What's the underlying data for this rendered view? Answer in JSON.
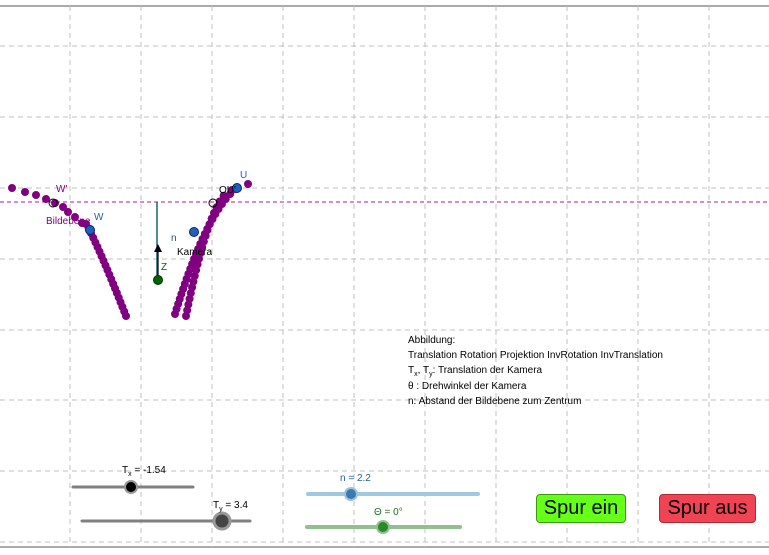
{
  "colors": {
    "grid": "#c0c0c0",
    "trace": "#800080",
    "bildebene": "#a020a0",
    "camera_point": "#006400",
    "blue_point": "#1f5fbf",
    "tx_slider": "#808080",
    "n_slider": "#a0c8e0",
    "theta_slider": "#90c090",
    "spur_ein": "#66ff1a",
    "spur_aus": "#f04455"
  },
  "labels": {
    "W_prime": "W'",
    "W": "W",
    "Bildebene": "Bildebene",
    "U": "U",
    "O_U_prime": "OU'",
    "n": "n",
    "Z": "Z",
    "Kamera": "Kamera"
  },
  "annotation": {
    "title": "Abbildung:",
    "line1": "Translation Rotation Projektion InvRotation InvTranslation",
    "line2_prefix": "T",
    "line2_sub_x": "x",
    "line2_mid": ", T",
    "line2_sub_y": "y",
    "line2_suffix": ": Translation der Kamera",
    "line3": "θ : Drehwinkel der Kamera",
    "line4": "n: Abstand der Bildebene zum Zentrum"
  },
  "sliders": {
    "tx": {
      "name": "T",
      "sub": "x",
      "value_text": " = -1.54",
      "value": -1.54,
      "min": -5,
      "max": 5
    },
    "ty": {
      "name": "T",
      "sub": "y",
      "value_text": " = 3.4",
      "value": 3.4,
      "min": -5,
      "max": 5
    },
    "n": {
      "label": "n = 2.2",
      "value": 2.2,
      "min": 0,
      "max": 10
    },
    "theta": {
      "label": "Θ = 0°",
      "value": 0,
      "min": -180,
      "max": 180
    }
  },
  "buttons": {
    "spur_ein": "Spur ein",
    "spur_aus": "Spur aus"
  }
}
